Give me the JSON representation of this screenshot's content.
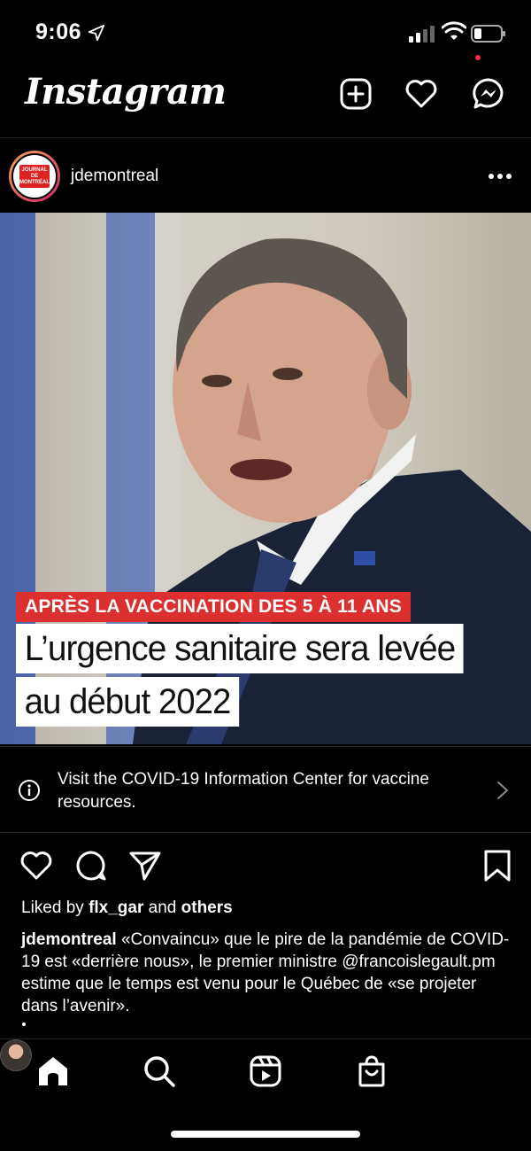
{
  "status_bar": {
    "time": "9:06",
    "icons": [
      "location-arrow-icon",
      "signal-icon",
      "wifi-icon",
      "battery-icon"
    ]
  },
  "header": {
    "logo_text": "Instagram",
    "icons": [
      "add-post-icon",
      "heart-icon",
      "messenger-icon"
    ]
  },
  "post": {
    "username": "jdemontreal",
    "avatar_text": [
      "JOURNAL",
      "DE",
      "MONTRÉAL"
    ],
    "image": {
      "kicker": "APRÈS LA VACCINATION DES 5 À 11 ANS",
      "headline_line1": "L’urgence sanitaire sera levée",
      "headline_line2": "au début 2022",
      "kicker_color": "#dc2f2f"
    },
    "covid_banner": {
      "text": "Visit the COVID-19 Information Center for vaccine resources."
    },
    "likes": {
      "prefix": "Liked by",
      "user": "flx_gar",
      "connector": "and",
      "others": "others"
    },
    "caption": {
      "user": "jdemontreal",
      "text": "«Convaincu» que le pire de la pandémie de COVID-19 est «derrière nous», le premier ministre @francoislegault.pm estime que le temps est venu pour le Québec de «se projeter dans l’avenir»."
    }
  },
  "tab_bar": {
    "items": [
      "home-icon",
      "search-icon",
      "reels-icon",
      "shop-icon",
      "profile-avatar"
    ],
    "notification_color": "#ff3040"
  }
}
